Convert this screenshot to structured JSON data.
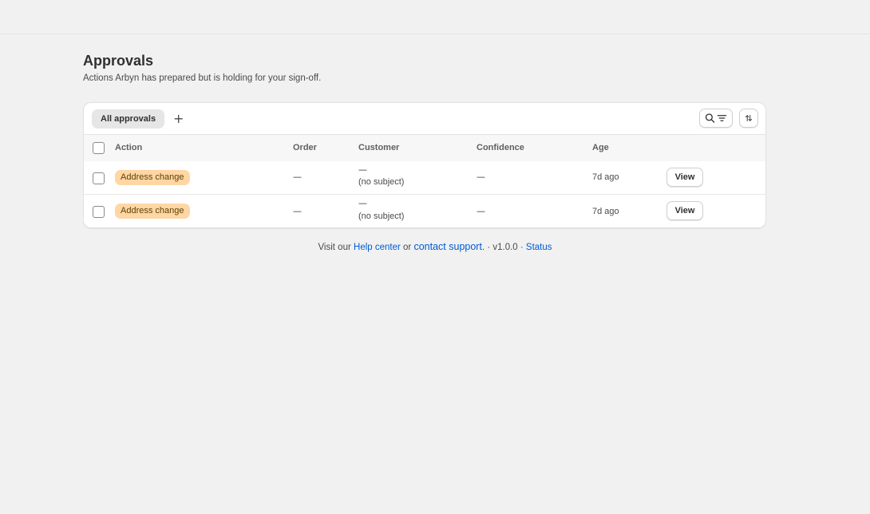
{
  "page": {
    "title": "Approvals",
    "subtitle": "Actions Arbyn has prepared but is holding for your sign-off."
  },
  "tabs": {
    "active_label": "All approvals",
    "add_label": "+"
  },
  "icons": {
    "search": "search-icon",
    "filter": "filter-lines-icon",
    "sort": "sort-arrows-icon"
  },
  "table": {
    "columns": [
      "Action",
      "Order",
      "Customer",
      "Confidence",
      "Age"
    ],
    "rows": [
      {
        "action": "Address change",
        "order": "—",
        "customer_name": "—",
        "customer_subject": "(no subject)",
        "confidence": "—",
        "age": "7d ago",
        "view_label": "View"
      },
      {
        "action": "Address change",
        "order": "—",
        "customer_name": "—",
        "customer_subject": "(no subject)",
        "confidence": "—",
        "age": "7d ago",
        "view_label": "View"
      }
    ]
  },
  "footer": {
    "prefix": "Visit our",
    "help_link": "Help center",
    "or": "or",
    "support_link": "contact support",
    "suffix": ". · v1.0.0 ·",
    "status_link": "Status"
  },
  "colors": {
    "background": "#f1f1f1",
    "badge_bg": "#ffd6a4",
    "link": "#005bd3"
  }
}
